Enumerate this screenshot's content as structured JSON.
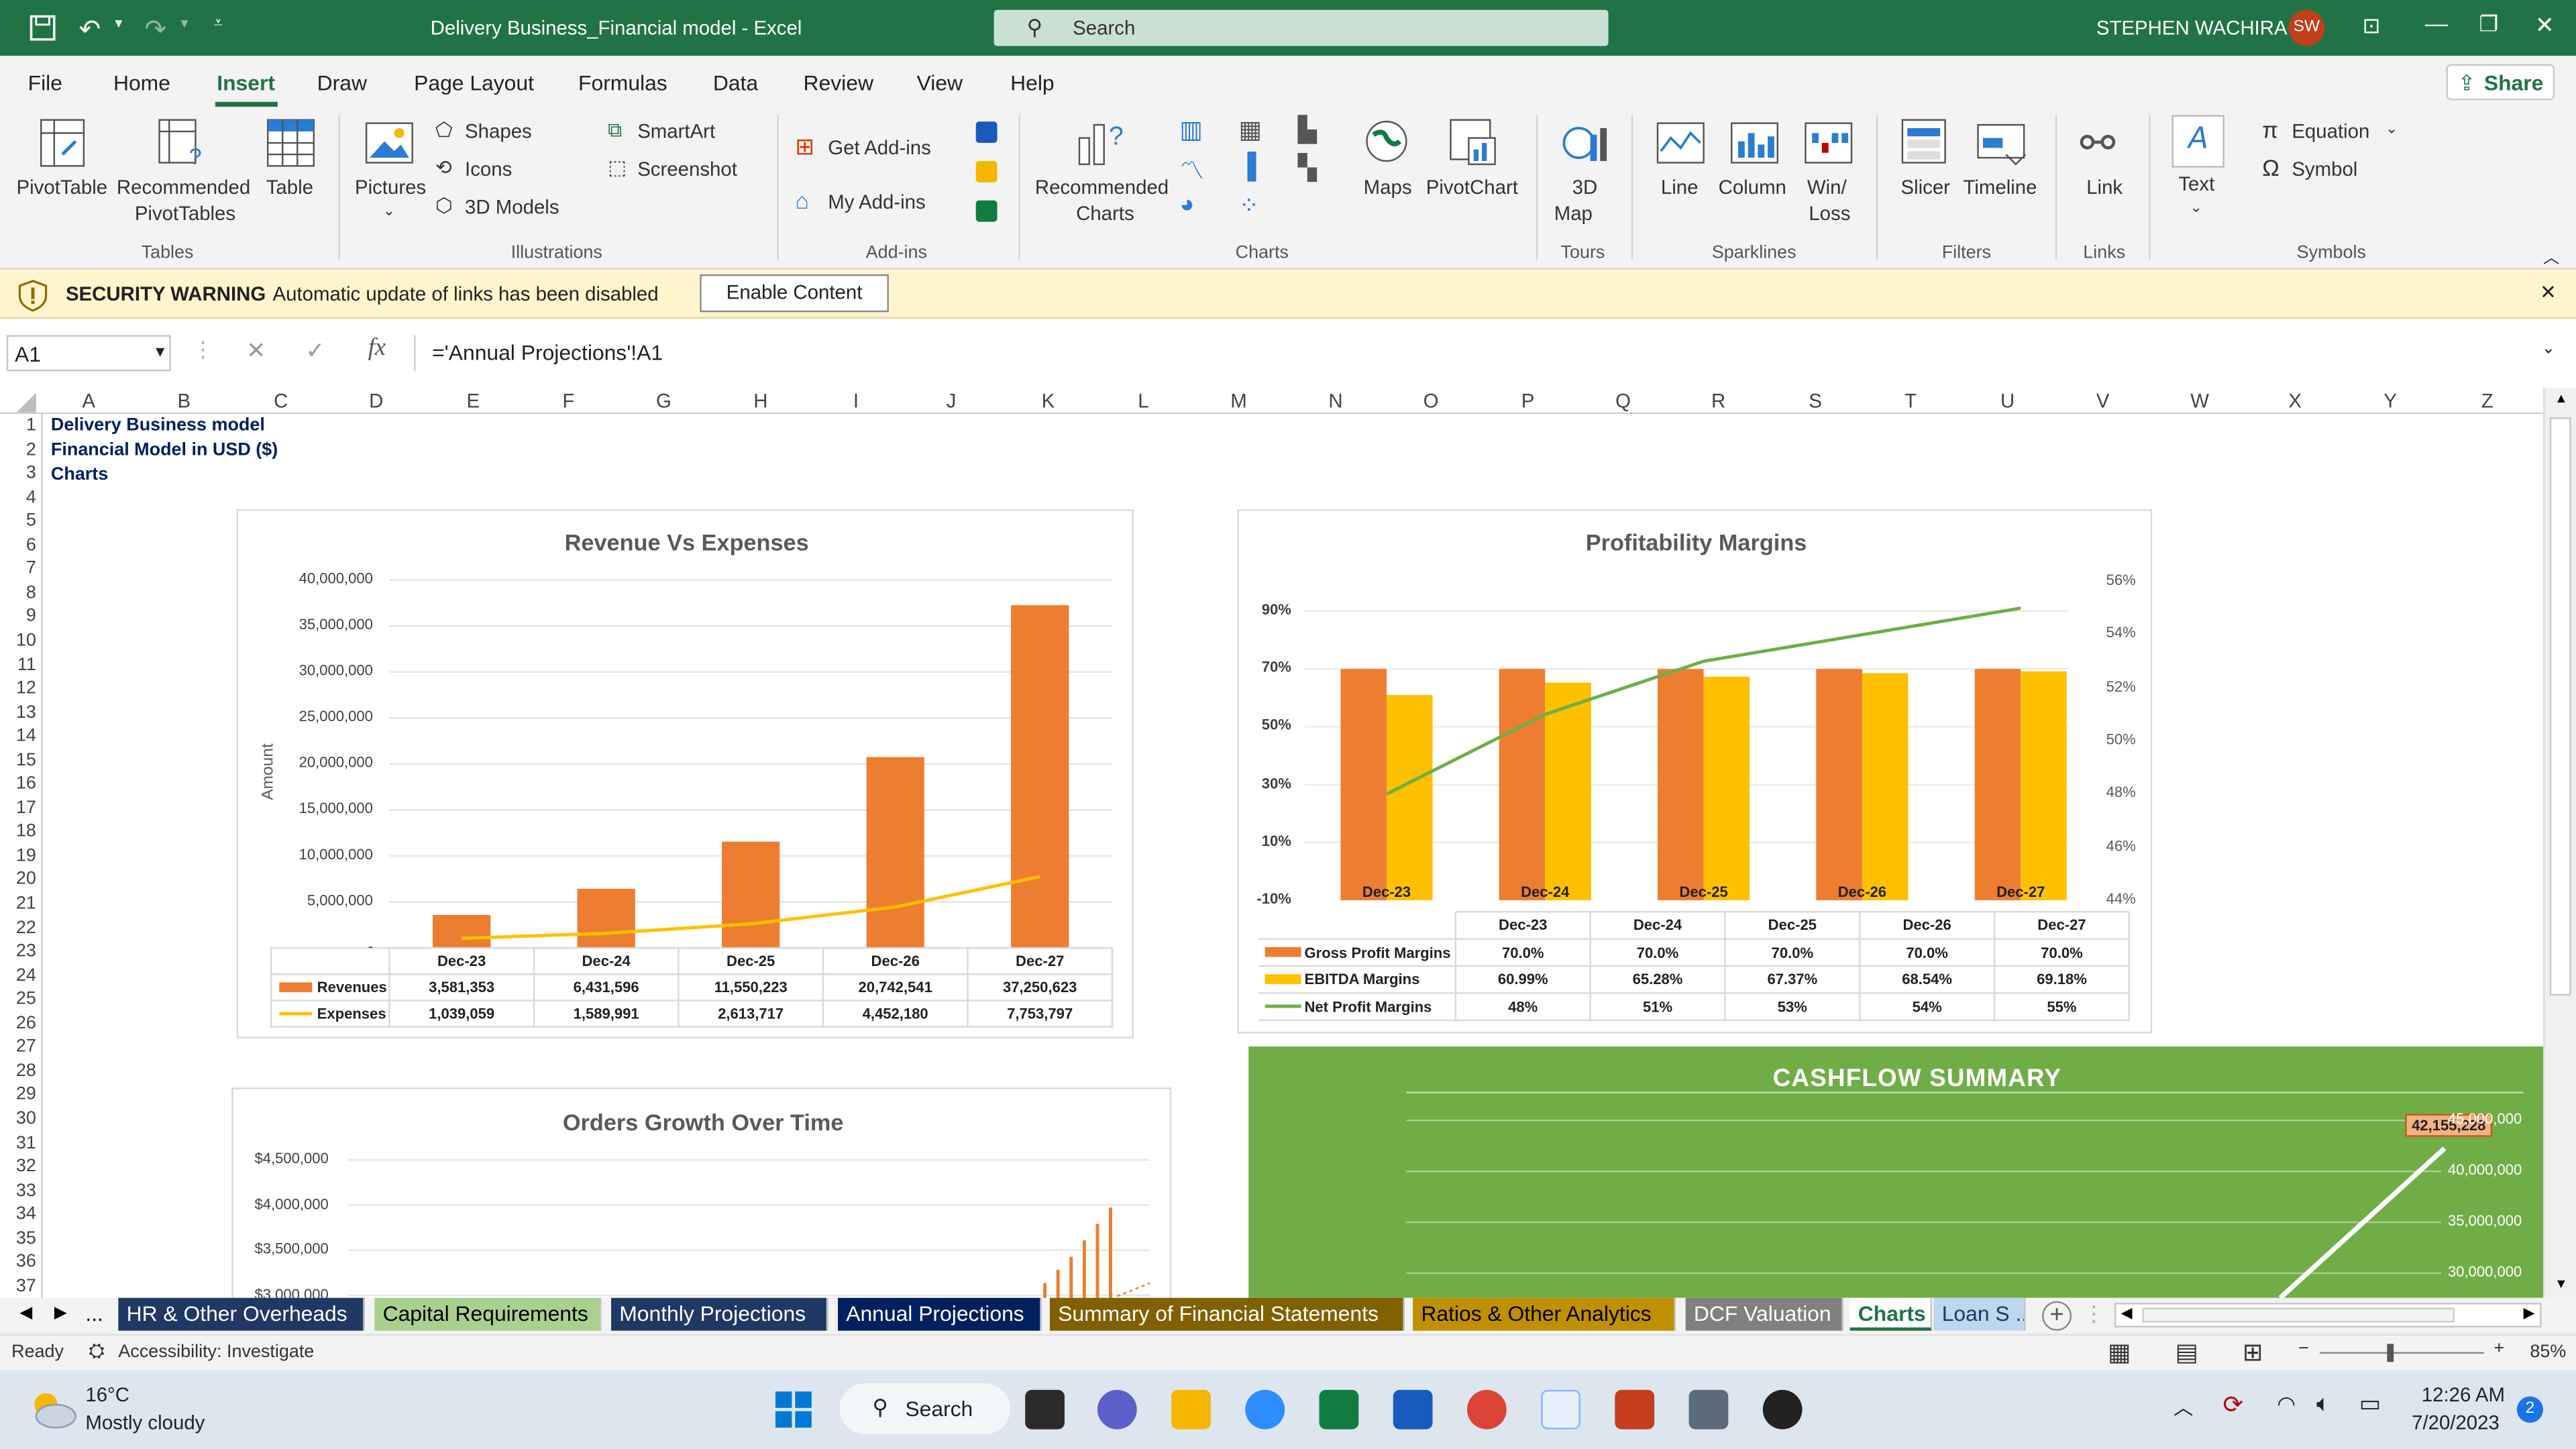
{
  "titlebar": {
    "doc_title": "Delivery Business_Financial model  -  Excel",
    "search_placeholder": "Search",
    "user_name": "STEPHEN WACHIRA",
    "user_initials": "SW"
  },
  "menu": {
    "items": [
      "File",
      "Home",
      "Insert",
      "Draw",
      "Page Layout",
      "Formulas",
      "Data",
      "Review",
      "View",
      "Help"
    ],
    "active": "Insert",
    "share_label": "Share"
  },
  "ribbon": {
    "pivottable": "PivotTable",
    "recommended_pivottables_1": "Recommended",
    "recommended_pivottables_2": "PivotTables",
    "table": "Table",
    "pictures": "Pictures",
    "shapes": "Shapes",
    "icons": "Icons",
    "models3d": "3D Models",
    "smartart": "SmartArt",
    "screenshot": "Screenshot",
    "get_addins": "Get Add-ins",
    "my_addins": "My Add-ins",
    "recommended_charts_1": "Recommended",
    "recommended_charts_2": "Charts",
    "maps": "Maps",
    "pivotchart": "PivotChart",
    "map3d_1": "3D",
    "map3d_2": "Map",
    "line": "Line",
    "column": "Column",
    "winloss_1": "Win/",
    "winloss_2": "Loss",
    "slicer": "Slicer",
    "timeline": "Timeline",
    "link": "Link",
    "text": "Text",
    "equation": "Equation",
    "symbol": "Symbol",
    "groups": {
      "tables": "Tables",
      "illustrations": "Illustrations",
      "addins": "Add-ins",
      "charts": "Charts",
      "tours": "Tours",
      "sparklines": "Sparklines",
      "filters": "Filters",
      "links": "Links",
      "symbols": "Symbols"
    }
  },
  "warning": {
    "title": "SECURITY WARNING",
    "message": "Automatic update of links has been disabled",
    "button": "Enable Content"
  },
  "formula": {
    "name_box": "A1",
    "fx": "fx",
    "content": "='Annual Projections'!A1"
  },
  "grid": {
    "columns": [
      "A",
      "B",
      "C",
      "D",
      "E",
      "F",
      "G",
      "H",
      "I",
      "J",
      "K",
      "L",
      "M",
      "N",
      "O",
      "P",
      "Q",
      "R",
      "S",
      "T",
      "U",
      "V",
      "W",
      "X",
      "Y",
      "Z"
    ],
    "rows": [
      "1",
      "2",
      "3",
      "4",
      "5",
      "6",
      "7",
      "8",
      "9",
      "10",
      "11",
      "12",
      "13",
      "14",
      "15",
      "16",
      "17",
      "18",
      "19",
      "20",
      "21",
      "22",
      "23",
      "24",
      "25",
      "26",
      "27",
      "28",
      "29",
      "30",
      "31",
      "32",
      "33",
      "34",
      "35",
      "36",
      "37"
    ],
    "cell_a1": "Delivery Business model",
    "cell_a2": "Financial  Model in USD ($)",
    "cell_a3": "Charts"
  },
  "charts": {
    "revenue": {
      "title": "Revenue Vs Expenses",
      "ylabel": "Amount",
      "yticks": [
        "40,000,000",
        "35,000,000",
        "30,000,000",
        "25,000,000",
        "20,000,000",
        "15,000,000",
        "10,000,000",
        "5,000,000",
        "-"
      ],
      "series_labels": [
        "Revenues",
        "Expenses"
      ],
      "revenues_text": [
        "3,581,353",
        "6,431,596",
        "11,550,223",
        "20,742,541",
        "37,250,623"
      ],
      "expenses_text": [
        "1,039,059",
        "1,589,991",
        "2,613,717",
        "4,452,180",
        "7,753,797"
      ]
    },
    "profitability": {
      "title": "Profitability Margins",
      "left_ticks": [
        "90%",
        "70%",
        "50%",
        "30%",
        "10%",
        "-10%"
      ],
      "right_ticks": [
        "56%",
        "54%",
        "52%",
        "50%",
        "48%",
        "46%",
        "44%"
      ],
      "series_labels": [
        "Gross Profit Margins",
        "EBITDA Margins",
        "Net Profit Margins"
      ],
      "gross_text": [
        "70.0%",
        "70.0%",
        "70.0%",
        "70.0%",
        "70.0%"
      ],
      "ebitda_text": [
        "60.99%",
        "65.28%",
        "67.37%",
        "68.54%",
        "69.18%"
      ],
      "net_text": [
        "48%",
        "51%",
        "53%",
        "54%",
        "55%"
      ]
    },
    "orders": {
      "title": "Orders Growth Over Time",
      "yticks": [
        "$4,500,000",
        "$4,000,000",
        "$3,500,000",
        "$3,000,000"
      ]
    },
    "cashflow": {
      "title": "CASHFLOW SUMMARY",
      "callout": "42,155,228",
      "yticks": [
        "45,000,000",
        "40,000,000",
        "35,000,000",
        "30,000,000"
      ]
    }
  },
  "chart_data": [
    {
      "type": "bar",
      "title": "Revenue Vs Expenses",
      "ylabel": "Amount",
      "categories": [
        "Dec-23",
        "Dec-24",
        "Dec-25",
        "Dec-26",
        "Dec-27"
      ],
      "ylim": [
        0,
        40000000
      ],
      "series": [
        {
          "name": "Revenues",
          "type": "bar",
          "color": "#ed7d31",
          "values": [
            3581353,
            6431596,
            11550223,
            20742541,
            37250623
          ]
        },
        {
          "name": "Expenses",
          "type": "line",
          "color": "#ffc000",
          "values": [
            1039059,
            1589991,
            2613717,
            4452180,
            7753797
          ]
        }
      ]
    },
    {
      "type": "bar",
      "title": "Profitability Margins",
      "categories": [
        "Dec-23",
        "Dec-24",
        "Dec-25",
        "Dec-26",
        "Dec-27"
      ],
      "ylim": [
        -10,
        90
      ],
      "y2lim": [
        44,
        56
      ],
      "series": [
        {
          "name": "Gross Profit Margins",
          "type": "bar",
          "color": "#ed7d31",
          "values": [
            70.0,
            70.0,
            70.0,
            70.0,
            70.0
          ]
        },
        {
          "name": "EBITDA Margins",
          "type": "bar",
          "color": "#ffc000",
          "values": [
            60.99,
            65.28,
            67.37,
            68.54,
            69.18
          ]
        },
        {
          "name": "Net Profit Margins",
          "type": "line",
          "axis": "secondary",
          "color": "#70ad47",
          "values": [
            48,
            51,
            53,
            54,
            55
          ]
        }
      ]
    }
  ],
  "tabs": {
    "nav": [
      "◀",
      "▶",
      "..."
    ],
    "sheets": [
      {
        "label": "HR & Other Overheads",
        "bg": "#1f3864",
        "fg": "#ffffff"
      },
      {
        "label": "Capital Requirements",
        "bg": "#a9d18e",
        "fg": "#000000"
      },
      {
        "label": "Monthly Projections",
        "bg": "#1f3864",
        "fg": "#ffffff"
      },
      {
        "label": "Annual Projections",
        "bg": "#002060",
        "fg": "#ffffff"
      },
      {
        "label": "Summary of Financial Statements",
        "bg": "#806000",
        "fg": "#ffffff"
      },
      {
        "label": "Ratios & Other Analytics",
        "bg": "#bf9000",
        "fg": "#000000"
      },
      {
        "label": "DCF Valuation",
        "bg": "#808080",
        "fg": "#ffffff"
      },
      {
        "label": "Charts",
        "bg": "#ffffff",
        "fg": "#217346"
      },
      {
        "label": "Loan S ...",
        "bg": "#bdd7ee",
        "fg": "#1f3864"
      }
    ]
  },
  "status": {
    "ready": "Ready",
    "accessibility": "Accessibility: Investigate",
    "zoom": "85%"
  },
  "taskbar": {
    "temp": "16°C",
    "weather": "Mostly cloudy",
    "search": "Search",
    "time": "12:26 AM",
    "date": "7/20/2023",
    "notif_count": "2"
  }
}
